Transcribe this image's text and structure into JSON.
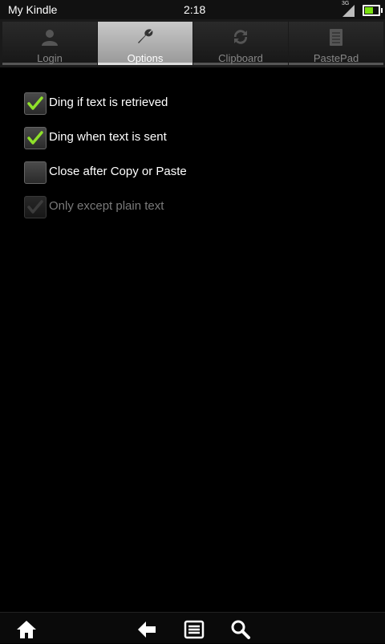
{
  "status_bar": {
    "title": "My Kindle",
    "time": "2:18",
    "network": "3G",
    "battery_color": "#7ae010"
  },
  "tabs": [
    {
      "label": "Login",
      "icon": "person-icon",
      "active": false
    },
    {
      "label": "Options",
      "icon": "wrench-icon",
      "active": true
    },
    {
      "label": "Clipboard",
      "icon": "refresh-icon",
      "active": false
    },
    {
      "label": "PastePad",
      "icon": "notepad-icon",
      "active": false
    }
  ],
  "options": [
    {
      "label": "Ding if text is retrieved",
      "checked": true,
      "enabled": true
    },
    {
      "label": "Ding when text is sent",
      "checked": true,
      "enabled": true
    },
    {
      "label": "Close after Copy or Paste",
      "checked": false,
      "enabled": true
    },
    {
      "label": "Only except plain text",
      "checked": true,
      "enabled": false
    }
  ],
  "bottom_nav": {
    "icons": [
      "home-icon",
      "back-arrow-icon",
      "menu-icon",
      "search-icon"
    ]
  },
  "colors": {
    "check_active": "#8fe02a",
    "check_disabled": "#6e6e6e"
  }
}
